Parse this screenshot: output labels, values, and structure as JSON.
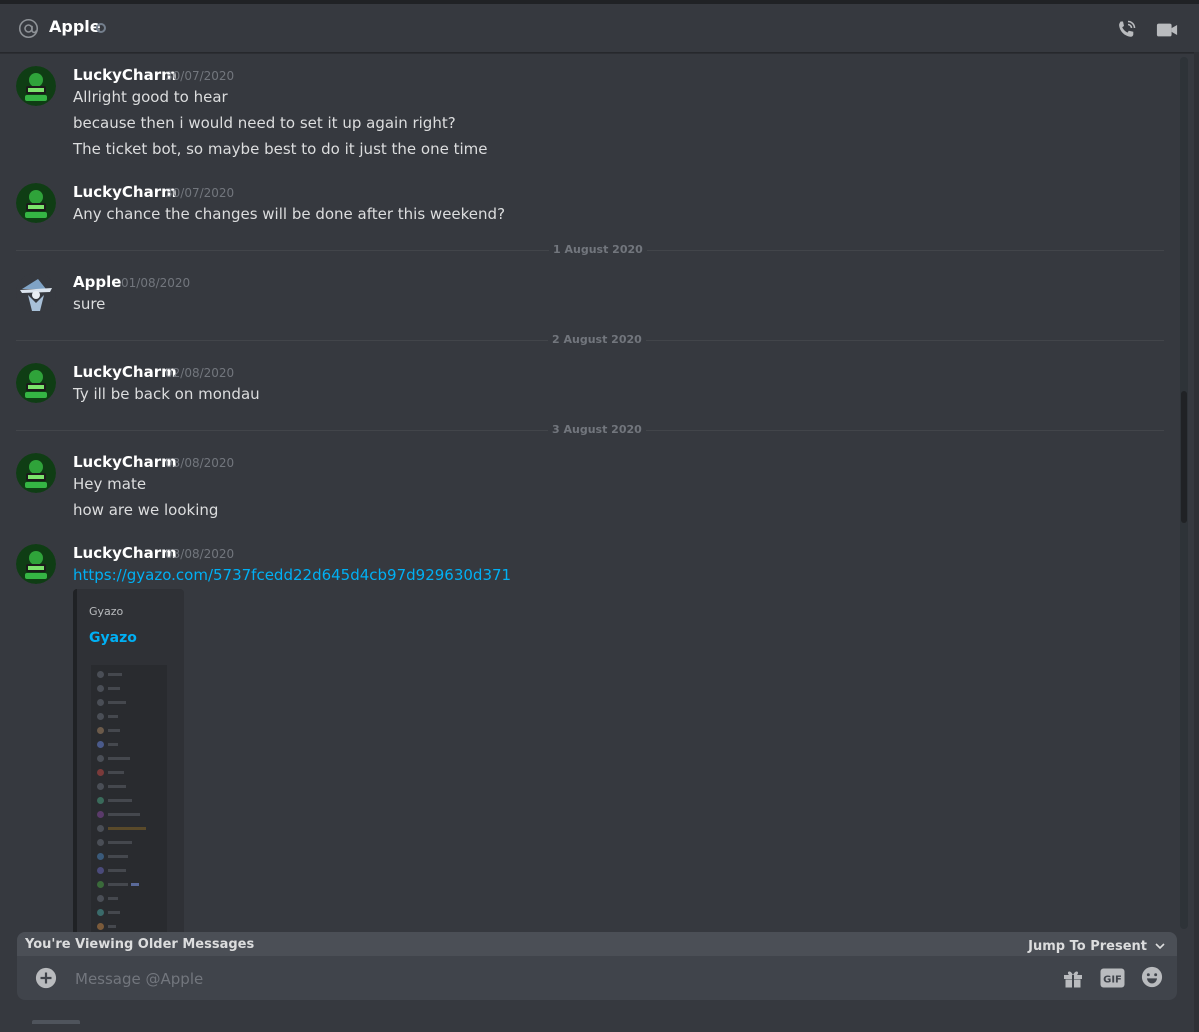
{
  "header": {
    "name": "Apple"
  },
  "messages": [
    {
      "author": "LuckyCharm",
      "timestamp": "30/07/2020",
      "lines": [
        "Allright good to hear",
        "because then i would need to set it up again right?",
        "The ticket bot, so maybe best to do it just the one time"
      ]
    },
    {
      "author": "LuckyCharm",
      "timestamp": "30/07/2020",
      "lines": [
        "Any chance the changes will be done after this weekend?"
      ]
    },
    {
      "divider": "1 August 2020",
      "author": "Apple",
      "timestamp": "01/08/2020",
      "lines": [
        "sure"
      ]
    },
    {
      "divider": "2 August 2020",
      "author": "LuckyCharm",
      "timestamp": "02/08/2020",
      "lines": [
        "Ty ill be back on mondau"
      ]
    },
    {
      "divider": "3 August 2020",
      "author": "LuckyCharm",
      "timestamp": "03/08/2020",
      "lines": [
        "Hey mate",
        "how are we looking"
      ]
    },
    {
      "author": "LuckyCharm",
      "timestamp": "03/08/2020",
      "link": "https://gyazo.com/5737fcedd22d645d4cb97d929630d371",
      "embed": {
        "provider": "Gyazo",
        "title": "Gyazo"
      }
    }
  ],
  "older_bar": {
    "text": "You're Viewing Older Messages",
    "jump_label": "Jump To Present"
  },
  "composer": {
    "placeholder": "Message @Apple",
    "gif_label": "GIF"
  },
  "colors": {
    "background": "#36393f",
    "link": "#00b0f4",
    "luckycharm_avatar": "#0f3d14",
    "apple_avatar": "#dbe4ee"
  }
}
